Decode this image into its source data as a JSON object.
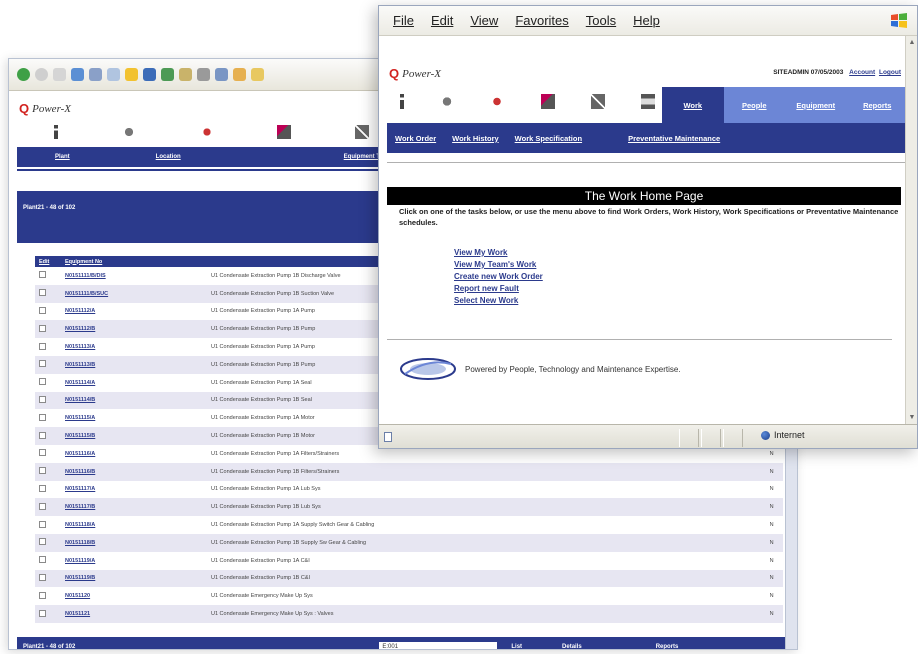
{
  "back_window": {
    "app_name": "Power-X",
    "nav": [
      "Plant",
      "Location",
      "Equipment Type"
    ],
    "plant_heading": "Plant21 - 48 of 102",
    "table": {
      "headers": [
        "Edit",
        "Equipment No",
        ""
      ],
      "rows": [
        [
          "N0151111/B/DIS",
          "U1 Condensate Extraction Pump 1B Discharge Valve",
          ""
        ],
        [
          "N0151111/B/SUC",
          "U1 Condensate Extraction Pump 1B Suction Valve",
          ""
        ],
        [
          "N0151112/A",
          "U1 Condensate Extraction Pump 1A Pump",
          ""
        ],
        [
          "N0151112/B",
          "U1 Condensate Extraction Pump 1B Pump",
          ""
        ],
        [
          "N0151113/A",
          "U1 Condensate Extraction Pump 1A Pump",
          ""
        ],
        [
          "N0151113/B",
          "U1 Condensate Extraction Pump 1B Pump",
          ""
        ],
        [
          "N0151114/A",
          "U1 Condensate Extraction Pump 1A Seal",
          ""
        ],
        [
          "N0151114/B",
          "U1 Condensate Extraction Pump 1B Seal",
          ""
        ],
        [
          "N0151115/A",
          "U1 Condensate Extraction Pump 1A Motor",
          ""
        ],
        [
          "N0151115/B",
          "U1 Condensate Extraction Pump 1B Motor",
          ""
        ],
        [
          "N0151116/A",
          "U1 Condensate Extraction Pump 1A Filters/Strainers",
          "N"
        ],
        [
          "N0151116/B",
          "U1 Condensate Extraction Pump 1B Filters/Strainers",
          "N"
        ],
        [
          "N0151117/A",
          "U1 Condensate Extraction Pump 1A Lub Sys",
          "N"
        ],
        [
          "N0151117/B",
          "U1 Condensate Extraction Pump 1B Lub Sys",
          "N"
        ],
        [
          "N0151118/A",
          "U1 Condensate Extraction Pump 1A Supply Switch Gear & Cabling",
          "N"
        ],
        [
          "N0151118/B",
          "U1 Condensate Extraction Pump 1B Supply Sw Gear & Cabling",
          "N"
        ],
        [
          "N0151119/A",
          "U1 Condensate Extraction Pump 1A C&I",
          "N"
        ],
        [
          "N0151119/B",
          "U1 Condensate Extraction Pump 1B C&I",
          "N"
        ],
        [
          "N0151120",
          "U1 Condensate Emergency Make Up Sys",
          "N"
        ],
        [
          "N0151121",
          "U1 Condensate Emergency Make Up Sys : Valves",
          "N"
        ]
      ]
    },
    "footer": {
      "plant_heading": "Plant21 - 48 of 102",
      "select_value": "E:001",
      "links": [
        "List",
        "Details",
        "Reports"
      ]
    }
  },
  "front_window": {
    "menu": [
      "File",
      "Edit",
      "View",
      "Favorites",
      "Tools",
      "Help"
    ],
    "app_name": "Power-X",
    "user": "SITEADMIN 07/05/2003",
    "account_link": "Account",
    "logout_link": "Logout",
    "tabs": [
      "Work",
      "People",
      "Equipment",
      "Reports"
    ],
    "active_tab": "Work",
    "subnav": [
      "Work Order",
      "Work History",
      "Work Specification",
      "Preventative Maintenance"
    ],
    "page_title": "The Work Home Page",
    "intro": "Click on one of the tasks below, or use the menu above to find Work Orders, Work History, Work Specifications or Preventative Maintenance schedules.",
    "links": [
      "View My Work",
      "View My Team's Work",
      "Create new Work Order",
      "Report new Fault",
      "Select New Work"
    ],
    "powered_by": "Powered by People, Technology and Maintenance Expertise.",
    "status_zone": "Internet"
  },
  "colors": {
    "brand_navy": "#2b3a8c",
    "tab_light": "#6c86d6",
    "row_stripe": "#e7e6f2",
    "logo_red": "#d2221f"
  }
}
